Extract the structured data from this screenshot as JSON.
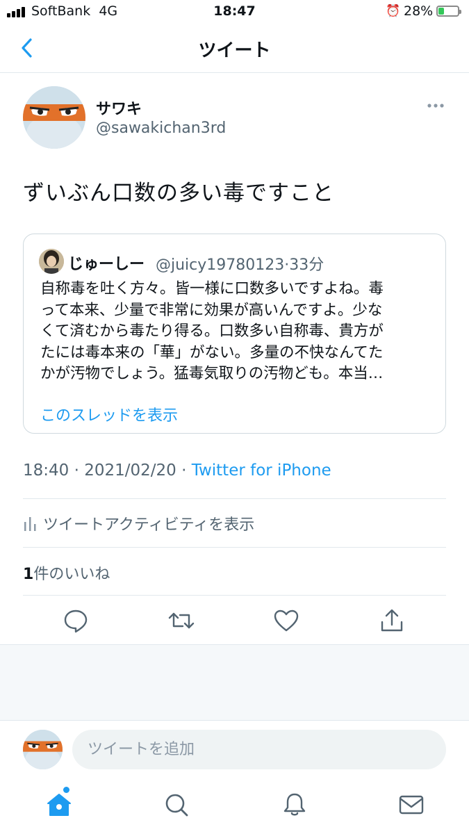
{
  "status_bar": {
    "carrier": "SoftBank",
    "network": "4G",
    "time": "18:47",
    "battery": "28%",
    "battery_level": 0.28
  },
  "header": {
    "title": "ツイート"
  },
  "tweet": {
    "author_name": "サワキ",
    "author_handle": "@sawakichan3rd",
    "text": "ずいぶん口数の多い毒ですこと",
    "timestamp": "18:40 · 2021/02/20 · ",
    "source": "Twitter for iPhone",
    "activity_label": "ツイートアクティビティを表示",
    "likes_count": "1",
    "likes_label": "件のいいね"
  },
  "quote": {
    "name": "じゅーしー",
    "meta": "@juicy19780123·33分",
    "text": "自称毒を吐く方々。皆一様に口数多いですよね。毒\nって本来、少量で非常に効果が高いんですよ。少な\nくて済むから毒たり得る。口数多い自称毒、貴方が\nたには毒本来の「華」がない。多量の不快なんてた\nかが汚物でしょう。猛毒気取りの汚物ども。本当…",
    "link": "このスレッドを表示"
  },
  "reply": {
    "placeholder": "ツイートを追加"
  },
  "colors": {
    "accent": "#1d9bf0",
    "text": "#0f1419",
    "secondary": "#536471",
    "divider": "#e1e8ed"
  },
  "icons": {
    "actions": [
      "reply-icon",
      "retweet-icon",
      "like-icon",
      "share-icon"
    ],
    "tabs": [
      "home-icon",
      "search-icon",
      "notifications-icon",
      "messages-icon"
    ]
  }
}
